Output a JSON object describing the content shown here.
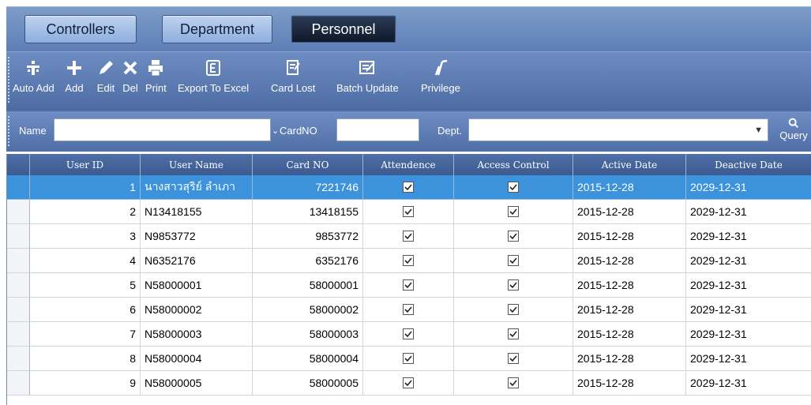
{
  "tabs": [
    {
      "label": "Controllers",
      "active": false
    },
    {
      "label": "Department",
      "active": false
    },
    {
      "label": "Personnel",
      "active": true
    }
  ],
  "toolbar": {
    "auto_add": "Auto Add",
    "add": "Add",
    "edit": "Edit",
    "del": "Del",
    "print": "Print",
    "export": "Export To Excel",
    "card_lost": "Card Lost",
    "batch_update": "Batch Update",
    "privilege": "Privilege"
  },
  "filter": {
    "name_label": "Name",
    "name_value": "",
    "cardno_label": "CardNO",
    "cardno_value": "",
    "dept_label": "Dept.",
    "dept_value": "",
    "query_label": "Query"
  },
  "table": {
    "columns": [
      "User ID",
      "User Name",
      "Card NO",
      "Attendence",
      "Access Control",
      "Active Date",
      "Deactive Date"
    ],
    "rows": [
      {
        "id": "1",
        "name": "นางสาวสุริย์ ลำเภา",
        "card": "7221746",
        "attendance": true,
        "access": true,
        "active": "2015-12-28",
        "deactive": "2029-12-31",
        "selected": true
      },
      {
        "id": "2",
        "name": "N13418155",
        "card": "13418155",
        "attendance": true,
        "access": true,
        "active": "2015-12-28",
        "deactive": "2029-12-31"
      },
      {
        "id": "3",
        "name": "N9853772",
        "card": "9853772",
        "attendance": true,
        "access": true,
        "active": "2015-12-28",
        "deactive": "2029-12-31"
      },
      {
        "id": "4",
        "name": "N6352176",
        "card": "6352176",
        "attendance": true,
        "access": true,
        "active": "2015-12-28",
        "deactive": "2029-12-31"
      },
      {
        "id": "5",
        "name": "N58000001",
        "card": "58000001",
        "attendance": true,
        "access": true,
        "active": "2015-12-28",
        "deactive": "2029-12-31"
      },
      {
        "id": "6",
        "name": "N58000002",
        "card": "58000002",
        "attendance": true,
        "access": true,
        "active": "2015-12-28",
        "deactive": "2029-12-31"
      },
      {
        "id": "7",
        "name": "N58000003",
        "card": "58000003",
        "attendance": true,
        "access": true,
        "active": "2015-12-28",
        "deactive": "2029-12-31"
      },
      {
        "id": "8",
        "name": "N58000004",
        "card": "58000004",
        "attendance": true,
        "access": true,
        "active": "2015-12-28",
        "deactive": "2029-12-31"
      },
      {
        "id": "9",
        "name": "N58000005",
        "card": "58000005",
        "attendance": true,
        "access": true,
        "active": "2015-12-28",
        "deactive": "2029-12-31"
      }
    ]
  },
  "colors": {
    "tab_strip": "#6f8ec3",
    "active_tab": "#1a2538",
    "selected_row": "#3d92dc",
    "header": "#45659c"
  }
}
